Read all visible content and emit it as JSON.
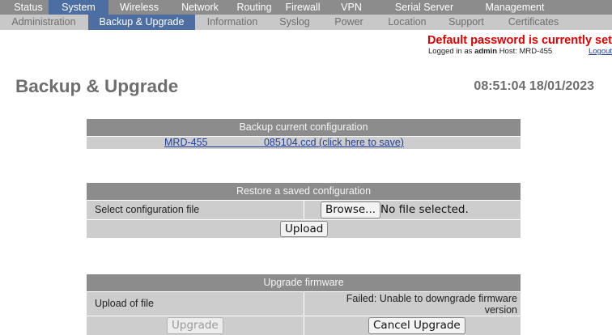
{
  "nav_primary": {
    "tabs": [
      {
        "label": "Status"
      },
      {
        "label": "System"
      },
      {
        "label": "Wireless"
      },
      {
        "label": "Network"
      },
      {
        "label": "Routing"
      },
      {
        "label": "Firewall"
      },
      {
        "label": "VPN"
      },
      {
        "label": "Serial Server"
      },
      {
        "label": "Management"
      }
    ],
    "active_index": 1
  },
  "nav_secondary": {
    "tabs": [
      {
        "label": "Administration"
      },
      {
        "label": "Backup & Upgrade"
      },
      {
        "label": "Information"
      },
      {
        "label": "Syslog"
      },
      {
        "label": "Power"
      },
      {
        "label": "Location"
      },
      {
        "label": "Support"
      },
      {
        "label": "Certificates"
      }
    ],
    "active_index": 1
  },
  "header": {
    "warning": "Default password is currently set",
    "logged_in_prefix": "Logged in as",
    "user": "admin",
    "host_label": "Host:",
    "host": "MRD-455",
    "logout": "Logout"
  },
  "page": {
    "title": "Backup & Upgrade",
    "datetime": "08:51:04 18/01/2023"
  },
  "backup": {
    "heading": "Backup current configuration",
    "link_text": "MRD-455                    085104.ccd (click here to save)"
  },
  "restore": {
    "heading": "Restore a saved configuration",
    "select_label": "Select configuration file",
    "browse_button": "Browse...",
    "no_file_text": "No file selected.",
    "upload_button": "Upload"
  },
  "firmware": {
    "heading": "Upgrade firmware",
    "upload_label": "Upload of file",
    "status_text": "Failed: Unable to downgrade firmware version",
    "upgrade_button": "Upgrade",
    "cancel_button": "Cancel Upgrade"
  },
  "colors": {
    "nav_primary_bg": "#8c8c8c",
    "nav_secondary_bg": "#c8c8c8",
    "active_tab_bg": "#4d6ea3",
    "warning_text": "#e00000",
    "link": "#1f3fa0",
    "panel_header_bg": "#8c8c8c",
    "panel_row_bg": "#cdcdcd"
  }
}
